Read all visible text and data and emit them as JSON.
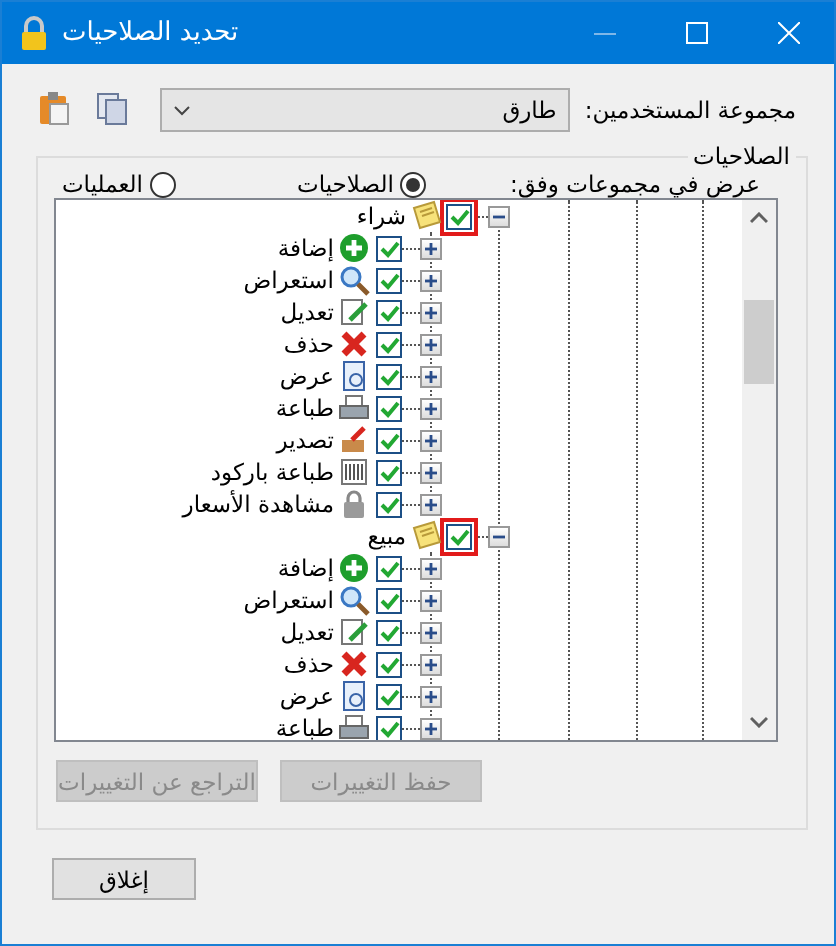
{
  "window": {
    "title": "تحديد الصلاحيات"
  },
  "user_group": {
    "label": "مجموعة المستخدمين:",
    "value": "طارق"
  },
  "permissions": {
    "legend": "الصلاحيات",
    "view_by": {
      "label": "عرض في مجموعات وفق:",
      "options": [
        {
          "label": "الصلاحيات",
          "selected": true
        },
        {
          "label": "العمليات",
          "selected": false
        }
      ]
    },
    "tree": [
      {
        "label": "شراء",
        "checked": true,
        "expanded": true,
        "highlighted": true,
        "children": [
          {
            "label": "إضافة",
            "checked": true,
            "expanded": false
          },
          {
            "label": "استعراض",
            "checked": true,
            "expanded": false
          },
          {
            "label": "تعديل",
            "checked": true,
            "expanded": false
          },
          {
            "label": "حذف",
            "checked": true,
            "expanded": false
          },
          {
            "label": "عرض",
            "checked": true,
            "expanded": false
          },
          {
            "label": "طباعة",
            "checked": true,
            "expanded": false
          },
          {
            "label": "تصدير",
            "checked": true,
            "expanded": false
          },
          {
            "label": "طباعة باركود",
            "checked": true,
            "expanded": false
          },
          {
            "label": "مشاهدة الأسعار",
            "checked": true,
            "expanded": false
          }
        ]
      },
      {
        "label": "مبيع",
        "checked": true,
        "expanded": true,
        "highlighted": true,
        "children": [
          {
            "label": "إضافة",
            "checked": true,
            "expanded": false
          },
          {
            "label": "استعراض",
            "checked": true,
            "expanded": false
          },
          {
            "label": "تعديل",
            "checked": true,
            "expanded": false
          },
          {
            "label": "حذف",
            "checked": true,
            "expanded": false
          },
          {
            "label": "عرض",
            "checked": true,
            "expanded": false
          },
          {
            "label": "طباعة",
            "checked": true,
            "expanded": false
          }
        ]
      }
    ],
    "buttons": [
      {
        "label": "حفظ التغييرات",
        "disabled": true
      },
      {
        "label": "التراجع عن التغييرات",
        "disabled": true
      }
    ]
  },
  "close_button": {
    "label": "إغلاق"
  }
}
